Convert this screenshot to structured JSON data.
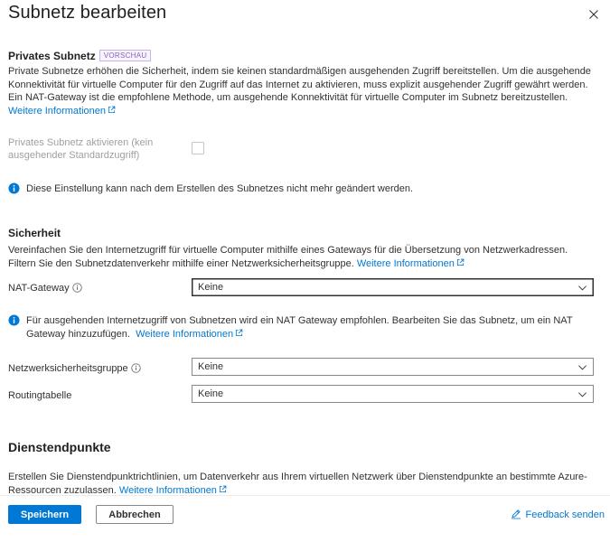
{
  "header": {
    "title": "Subnetz bearbeiten",
    "close_icon": "close-icon"
  },
  "private_subnet": {
    "heading": "Privates Subnetz",
    "badge": "VORSCHAU",
    "description": "Private Subnetze erhöhen die Sicherheit, indem sie keinen standardmäßigen ausgehenden Zugriff bereitstellen. Um die ausgehende Konnektivität für virtuelle Computer für den Zugriff auf das Internet zu aktivieren, muss explizit ausgehender Zugriff gewährt werden. Ein NAT-Gateway ist die empfohlene Methode, um ausgehende Konnektivität für virtuelle Computer im Subnetz bereitzustellen.",
    "link": "Weitere Informationen",
    "checkbox_label": "Privates Subnetz aktivieren (kein ausgehender Standardzugriff)",
    "checkbox_checked": false,
    "notice": "Diese Einstellung kann nach dem Erstellen des Subnetzes nicht mehr geändert werden."
  },
  "security": {
    "heading": "Sicherheit",
    "description": "Vereinfachen Sie den Internetzugriff für virtuelle Computer mithilfe eines Gateways für die Übersetzung von Netzwerkadressen. Filtern Sie den Subnetzdatenverkehr mithilfe einer Netzwerksicherheitsgruppe.",
    "link": "Weitere Informationen",
    "nat_gateway": {
      "label": "NAT-Gateway",
      "value": "Keine"
    },
    "nat_notice": "Für ausgehenden Internetzugriff von Subnetzen wird ein NAT Gateway empfohlen. Bearbeiten Sie das Subnetz, um ein NAT Gateway hinzuzufügen.",
    "nat_notice_link": "Weitere Informationen",
    "nsg": {
      "label": "Netzwerksicherheitsgruppe",
      "value": "Keine"
    },
    "route_table": {
      "label": "Routingtabelle",
      "value": "Keine"
    }
  },
  "service_endpoints": {
    "heading": "Dienstendpunkte",
    "description": "Erstellen Sie Dienstendpunktrichtlinien, um Datenverkehr aus Ihrem virtuellen Netzwerk über Dienstendpunkte an bestimmte Azure-Ressourcen zuzulassen.",
    "link": "Weitere Informationen"
  },
  "footer": {
    "save_label": "Speichern",
    "cancel_label": "Abbrechen",
    "feedback_label": "Feedback senden"
  },
  "colors": {
    "accent": "#0078d4",
    "badge": "#8764b8",
    "text": "#323130"
  }
}
